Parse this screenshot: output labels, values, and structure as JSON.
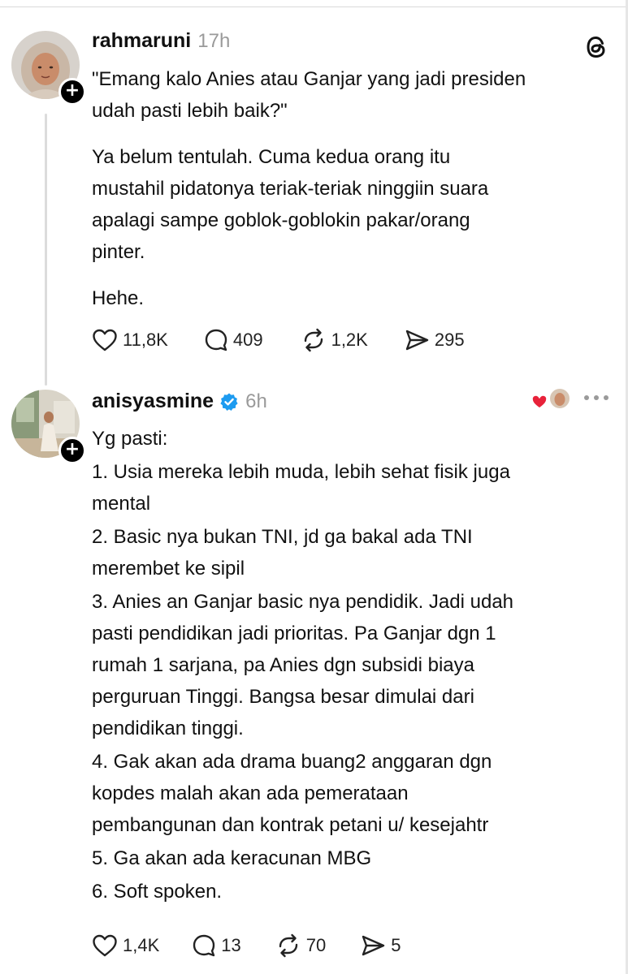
{
  "post1": {
    "username": "rahmaruni",
    "time": "17h",
    "quote": "\"Emang kalo Anies atau Ganjar yang jadi presiden\nudah pasti lebih baik?\"",
    "paragraph": "Ya belum tentulah. Cuma kedua orang itu\nmustahil pidatonya teriak-teriak ninggiin suara\napalagi sampe goblok-goblokin pakar/orang\npinter.",
    "closing": "Hehe.",
    "likes": "11,8K",
    "replies": "409",
    "reposts": "1,2K",
    "shares": "295"
  },
  "post2": {
    "username": "anisyasmine",
    "time": "6h",
    "lines": [
      "Yg pasti:",
      "1. Usia mereka lebih muda, lebih sehat fisik juga\nmental",
      "2. Basic nya bukan TNI, jd ga bakal ada TNI\nmerembet ke sipil",
      "3. Anies an Ganjar basic nya pendidik. Jadi udah\npasti pendidikan jadi prioritas.  Pa Ganjar dgn 1\nrumah 1 sarjana, pa Anies dgn subsidi biaya\nperguruan Tinggi. Bangsa besar dimulai dari\npendidikan tinggi.",
      "4. Gak akan ada drama buang2 anggaran dgn\nkopdes malah akan ada pemerataan\npembangunan dan kontrak petani u/ kesejahtr",
      "5. Ga akan ada keracunan MBG",
      "6. Soft spoken."
    ],
    "likes": "1,4K",
    "replies": "13",
    "reposts": "70",
    "shares": "5"
  },
  "icons": {
    "like": "heart-icon",
    "reply": "comment-icon",
    "repost": "repost-icon",
    "share": "share-icon",
    "logo": "threads-logo-icon",
    "more": "more-dots-icon",
    "follow": "plus-icon",
    "verified": "verified-badge-icon"
  },
  "colors": {
    "text": "#111111",
    "muted": "#9a9a9a",
    "verified": "#1d9bf0",
    "heart_red": "#e8223a"
  }
}
